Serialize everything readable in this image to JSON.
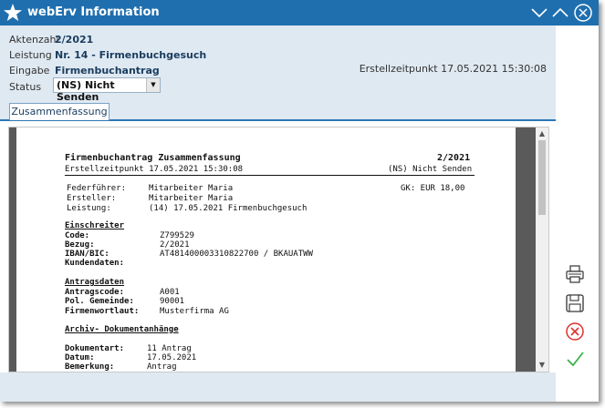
{
  "window": {
    "title": "webErv Information",
    "buttons": [
      "minimize",
      "maximize",
      "close"
    ]
  },
  "header": {
    "aktenzahl_label": "Aktenzahl",
    "aktenzahl_value": "2/2021",
    "leistung_label": "Leistung",
    "leistung_value": "Nr. 14 - Firmenbuchgesuch",
    "eingabe_label": "Eingabe",
    "eingabe_value": "Firmenbuchantrag",
    "status_label": "Status",
    "status_value": "(NS) Nicht Senden",
    "erstellzeitpunkt": "Erstellzeitpunkt 17.05.2021 15:30:08"
  },
  "tabs": [
    {
      "label": "Zusammenfassung"
    }
  ],
  "document": {
    "title": "Firmenbuchantrag Zusammenfassung",
    "number": "2/2021",
    "subtitle": "Erstellzeitpunkt 17.05.2021 15:30:08",
    "status": "(NS) Nicht Senden",
    "federfuehrer_label": "Federführer:",
    "federfuehrer_value": "Mitarbeiter Maria",
    "gk": "GK: EUR 18,00",
    "ersteller_label": "Ersteller:",
    "ersteller_value": "Mitarbeiter Maria",
    "leistung_label": "Leistung:",
    "leistung_value": "(14) 17.05.2021 Firmenbuchgesuch",
    "einschreiter_heading": "Einschreiter",
    "code_label": "Code:",
    "code_value": "Z799529",
    "bezug_label": "Bezug:",
    "bezug_value": "2/2021",
    "iban_label": "IBAN/BIC:",
    "iban_value": "AT481400003310822700 / BKAUATWW",
    "kundendaten_label": "Kundendaten:",
    "antragsdaten_heading": "Antragsdaten",
    "antragscode_label": "Antragscode:",
    "antragscode_value": "A001",
    "gemeinde_label": "Pol. Gemeinde:",
    "gemeinde_value": "90001",
    "firmenwortlaut_label": "Firmenwortlaut:",
    "firmenwortlaut_value": "Musterfirma AG",
    "archiv_heading": "Archiv- Dokumentanhänge",
    "dokumentart_label": "Dokumentart:",
    "dokumentart_value": "11 Antrag",
    "datum_label": "Datum:",
    "datum_value": "17.05.2021",
    "bemerkung_label": "Bemerkung:",
    "bemerkung_value": "Antrag"
  },
  "side_actions": [
    "print-icon",
    "save-icon",
    "cancel-icon",
    "confirm-icon"
  ],
  "colors": {
    "titlebar": "#1f6faf",
    "header_bg": "#dfe9f2",
    "cancel": "#e0302c",
    "confirm": "#3cb24a"
  }
}
